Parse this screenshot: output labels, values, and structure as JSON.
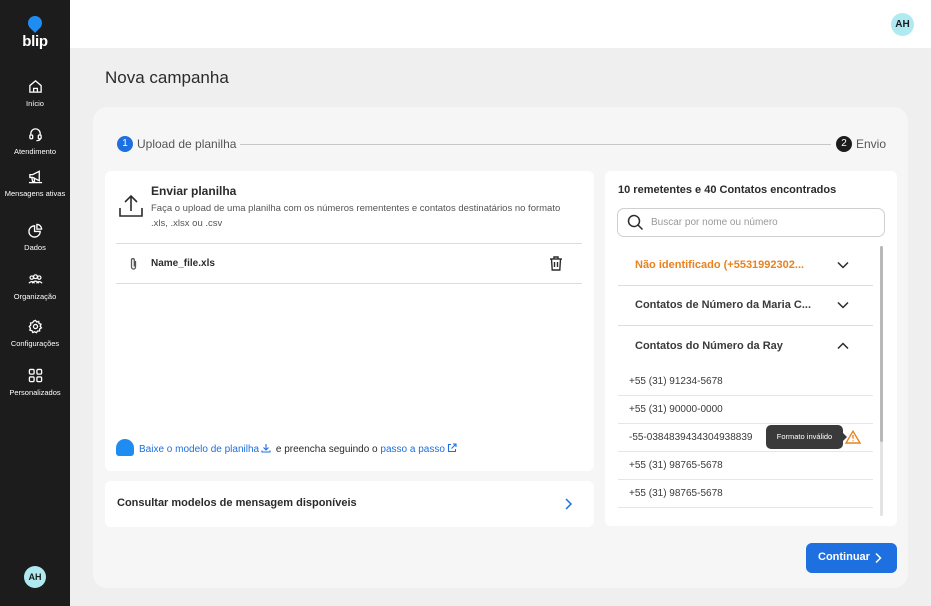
{
  "sidebar": {
    "logo": "blip",
    "items": [
      {
        "label": "Início",
        "icon": "home-icon"
      },
      {
        "label": "Atendimento",
        "icon": "headset-icon"
      },
      {
        "label": "Mensagens ativas",
        "icon": "megaphone-icon"
      },
      {
        "label": "Dados",
        "icon": "pie-chart-icon"
      },
      {
        "label": "Organização",
        "icon": "users-icon"
      },
      {
        "label": "Configurações",
        "icon": "gear-icon"
      },
      {
        "label": "Personalizados",
        "icon": "grid-icon"
      }
    ],
    "avatar": "AH"
  },
  "topbar": {
    "avatar": "AH"
  },
  "page": {
    "title": "Nova campanha"
  },
  "stepper": {
    "step1": {
      "number": "1",
      "label": "Upload de planilha"
    },
    "step2": {
      "number": "2",
      "label": "Envio"
    }
  },
  "upload": {
    "title": "Enviar planilha",
    "description": "Faça o upload de uma planilha com os números remententes e contatos destinatários no formato .xls, .xlsx ou .csv",
    "file_name": "Name_file.xls",
    "model_link": "Baixe o modelo de planilha",
    "model_middle": "e preencha seguindo o",
    "model_step_link": "passo a passo"
  },
  "consult": {
    "label": "Consultar modelos de mensagem disponíveis"
  },
  "contacts": {
    "summary": "10 remetentes e 40 Contatos encontrados",
    "search_placeholder": "Buscar por nome ou número",
    "groups": [
      {
        "title": "Não identificado (+5531992302...",
        "expanded": false,
        "color": "#e8821e"
      },
      {
        "title": "Contatos de Número da Maria C...",
        "expanded": false
      },
      {
        "title": "Contatos do Número da Ray",
        "expanded": true
      }
    ],
    "phones": [
      "+55 (31) 91234-5678",
      "+55 (31) 90000-0000",
      "-55-0384839434304938839",
      "+55 (31) 98765-5678",
      "+55 (31) 98765-5678"
    ],
    "invalid_tooltip": "Formato inválido"
  },
  "actions": {
    "continue": "Continuar"
  },
  "colors": {
    "primary": "#1e6fe0",
    "warning": "#e8821e",
    "sidebar": "#1c1c1c",
    "avatar": "#aeeaf0"
  }
}
